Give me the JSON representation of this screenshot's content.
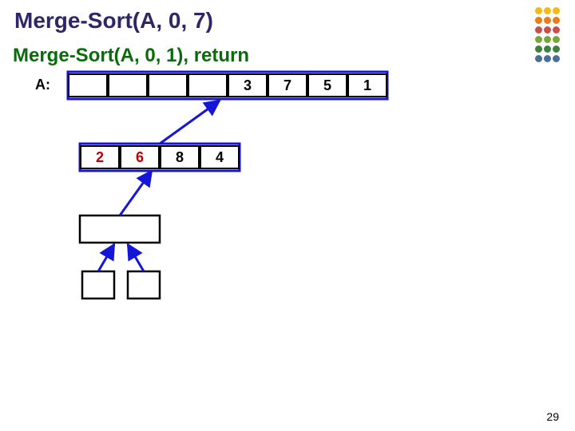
{
  "titles": {
    "main": "Merge-Sort(A, 0, 7)",
    "sub": "Merge-Sort(A, 0, 1), return"
  },
  "array_label": "A:",
  "array_top_right": [
    "3",
    "7",
    "5",
    "1"
  ],
  "row2": [
    "2",
    "6",
    "8",
    "4"
  ],
  "dot_colors": [
    [
      "#f5b915",
      "#f5b915",
      "#f5b915"
    ],
    [
      "#e87d1a",
      "#e87d1a",
      "#e87d1a"
    ],
    [
      "#c94f4f",
      "#c94f4f",
      "#c94f4f"
    ],
    [
      "#7aa53a",
      "#7aa53a",
      "#7aa53a"
    ],
    [
      "#3f7f3f",
      "#3f7f3f",
      "#3f7f3f"
    ],
    [
      "#4a6d9b",
      "#4a6d9b",
      "#4a6d9b"
    ]
  ],
  "slide_number": "29"
}
